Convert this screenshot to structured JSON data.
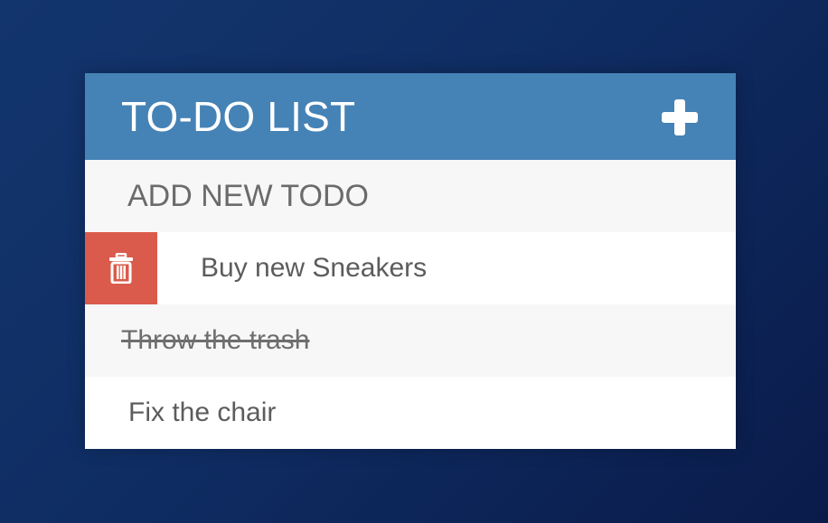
{
  "header": {
    "title": "TO-DO LIST",
    "add_icon": "plus-icon"
  },
  "new_todo": {
    "placeholder": "ADD NEW TODO",
    "value": ""
  },
  "todos": [
    {
      "text": "Buy new Sneakers",
      "completed": false,
      "hovered": true,
      "delete_icon": "trash-icon"
    },
    {
      "text": "Throw the trash",
      "completed": true,
      "hovered": false
    },
    {
      "text": "Fix the chair",
      "completed": false,
      "hovered": false
    }
  ],
  "colors": {
    "header_bg": "#4582b6",
    "delete_bg": "#da5b4b",
    "row_alt_bg": "#f7f7f7",
    "page_bg": "#0f2d63"
  }
}
